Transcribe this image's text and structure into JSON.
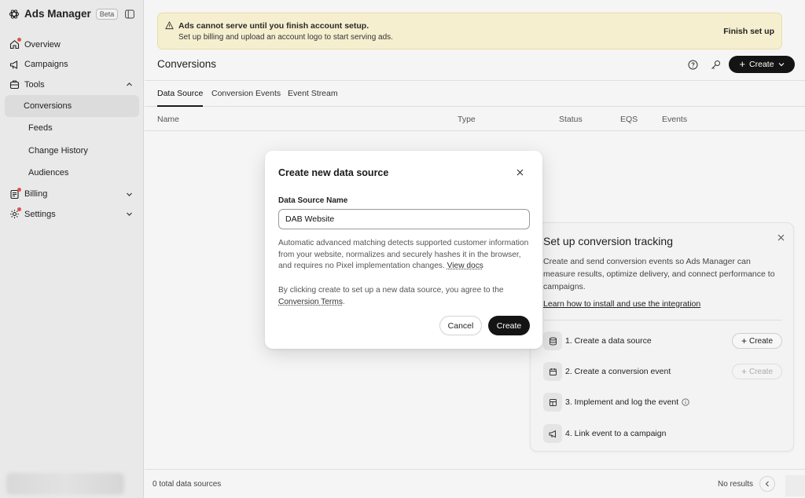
{
  "brand": {
    "name": "Ads Manager",
    "badge": "Beta"
  },
  "sidebar": {
    "items": [
      {
        "label": "Overview",
        "icon": "home-icon"
      },
      {
        "label": "Campaigns",
        "icon": "megaphone-icon"
      },
      {
        "label": "Tools",
        "icon": "briefcase-icon"
      },
      {
        "label": "Billing",
        "icon": "billing-icon"
      },
      {
        "label": "Settings",
        "icon": "gear-icon"
      }
    ],
    "tools_sub": [
      "Conversions",
      "Feeds",
      "Change History",
      "Audiences"
    ]
  },
  "banner": {
    "title": "Ads cannot serve until you finish account setup.",
    "subtitle": "Set up billing and upload an account logo to start serving ads.",
    "action": "Finish set up"
  },
  "header": {
    "title": "Conversions",
    "create_label": "Create"
  },
  "tabs": [
    "Data Source",
    "Conversion Events",
    "Event Stream"
  ],
  "table": {
    "columns": [
      "Name",
      "Type",
      "Status",
      "EQS",
      "Events"
    ]
  },
  "footer": {
    "count": "0 total data sources",
    "no_results": "No results"
  },
  "tracking_card": {
    "title": "Set up conversion tracking",
    "description": "Create and send conversion events so Ads Manager can measure results, optimize delivery, and connect performance to campaigns.",
    "link": "Learn how to install and use the integration",
    "steps": [
      {
        "label": "1. Create a data source",
        "button": "Create"
      },
      {
        "label": "2. Create a conversion event",
        "button": "Create"
      },
      {
        "label": "3. Implement and log the event"
      },
      {
        "label": "4. Link event to a campaign"
      }
    ]
  },
  "modal": {
    "title": "Create new data source",
    "field_label": "Data Source Name",
    "field_value": "DAB Website",
    "description": "Automatic advanced matching detects supported customer information from your website, normalizes and securely hashes it in the browser, and requires no Pixel implementation changes.",
    "docs_link": "View docs",
    "terms_prefix": "By clicking create to set up a new data source, you agree to the",
    "terms_link": "Conversion Terms",
    "terms_suffix": ".",
    "cancel": "Cancel",
    "create": "Create"
  },
  "colors": {
    "accent": "#141414",
    "banner_bg": "#f6efcf",
    "notification_dot": "#e0524b"
  }
}
